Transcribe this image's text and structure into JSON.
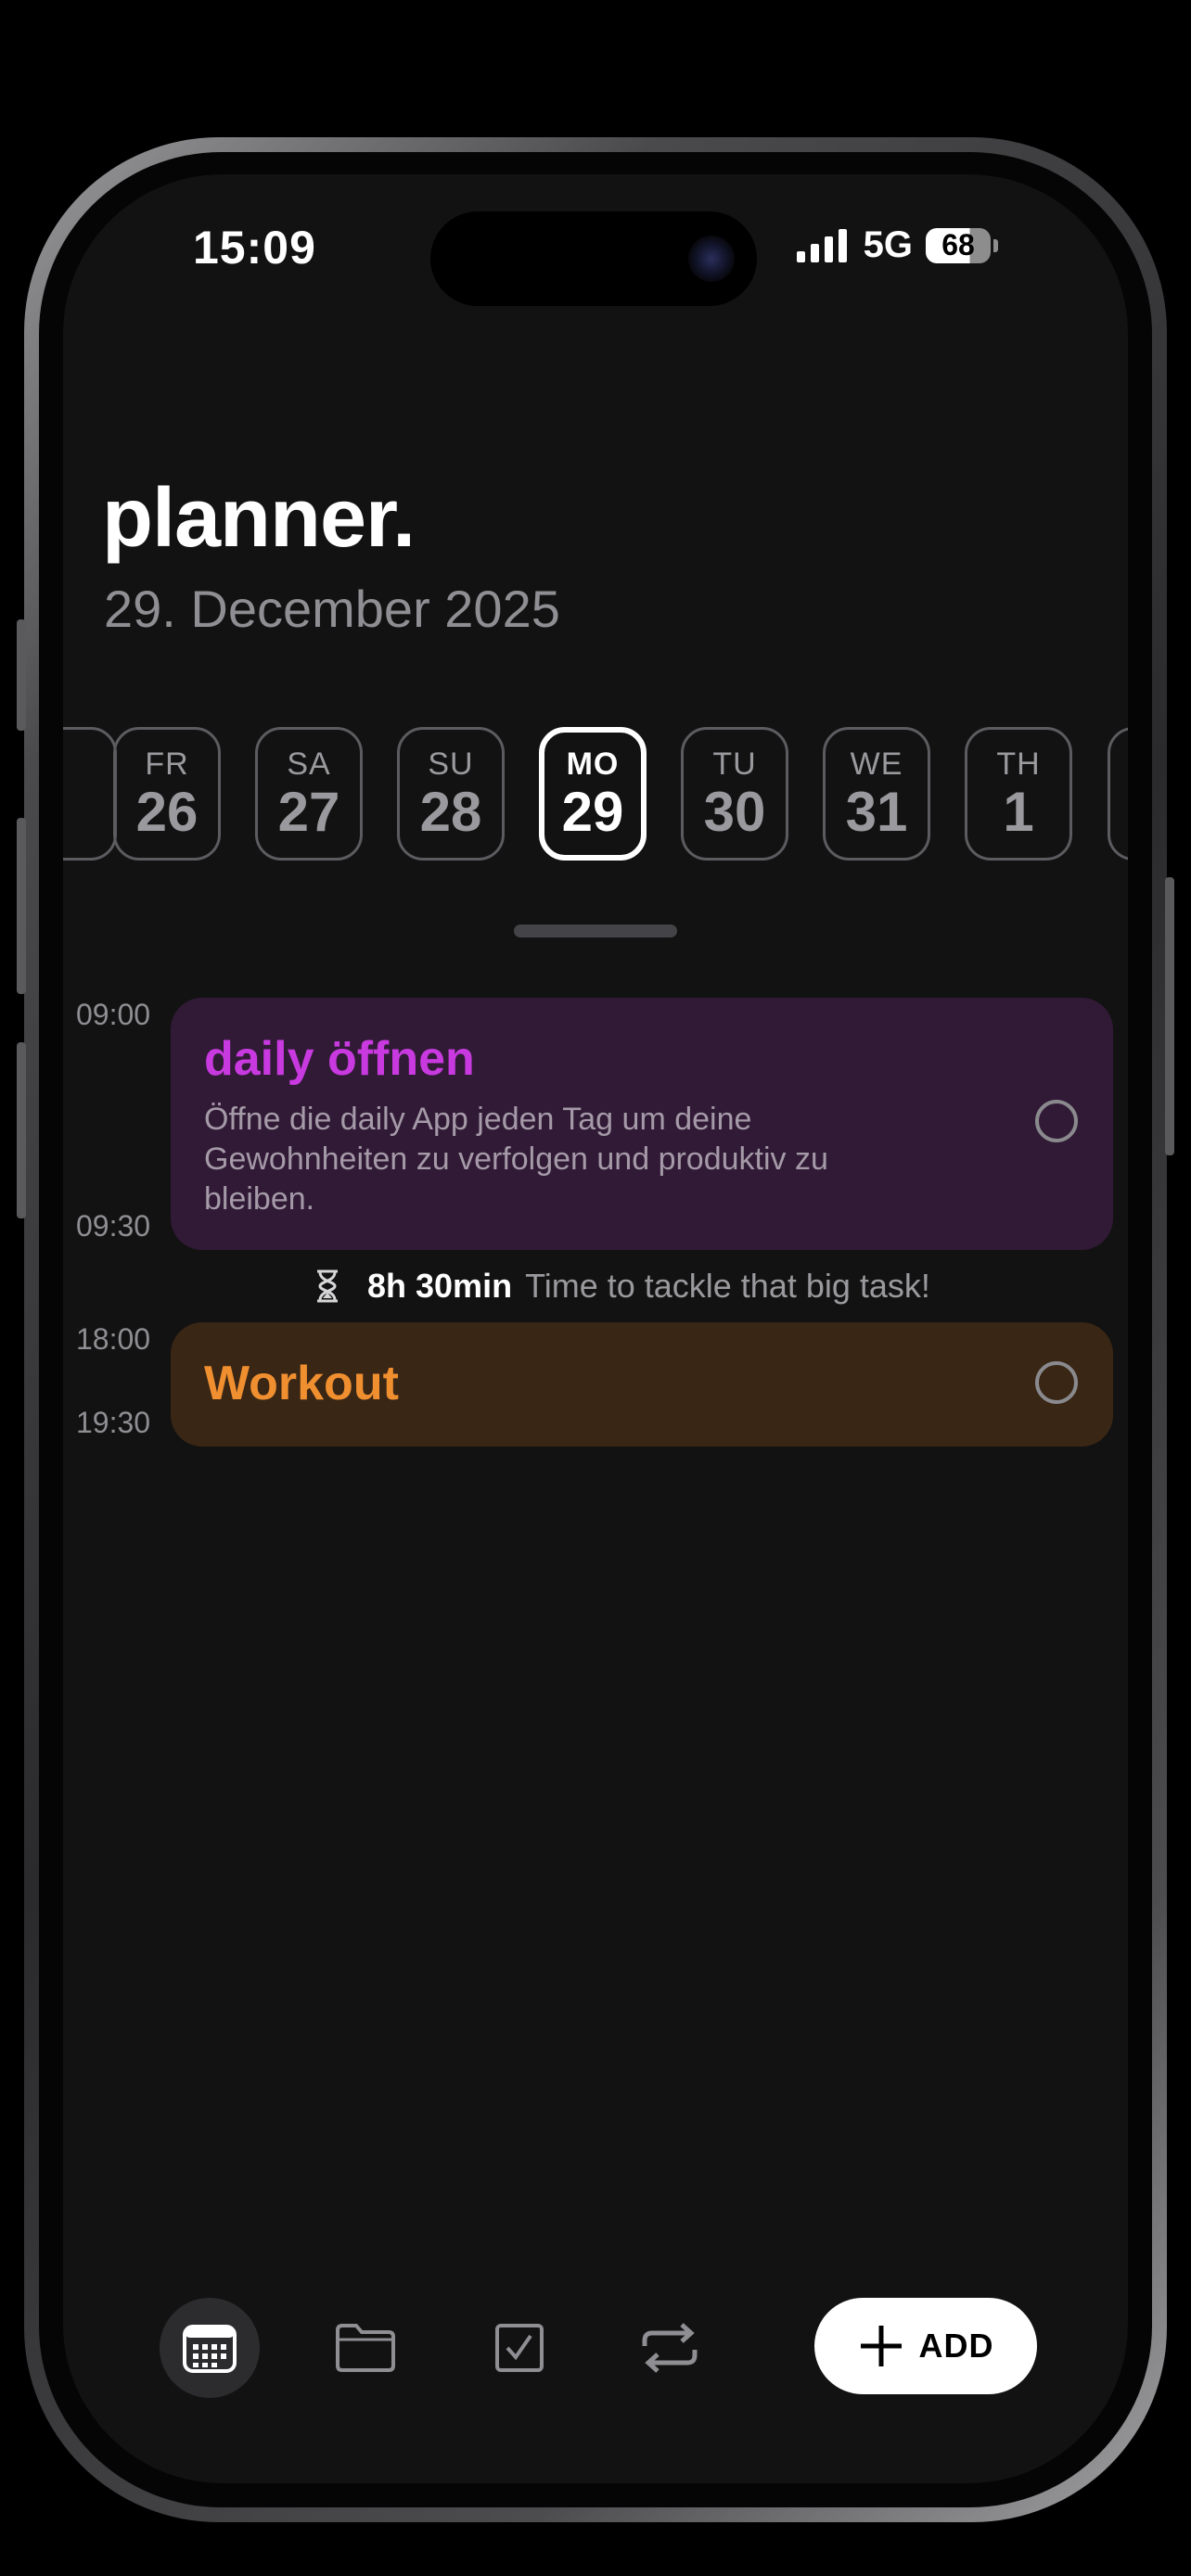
{
  "status_bar": {
    "time": "15:09",
    "network": "5G",
    "battery": "68"
  },
  "header": {
    "title": "planner.",
    "date": "29. December 2025"
  },
  "days": [
    {
      "name": "FR",
      "num": "26",
      "selected": false
    },
    {
      "name": "SA",
      "num": "27",
      "selected": false
    },
    {
      "name": "SU",
      "num": "28",
      "selected": false
    },
    {
      "name": "MO",
      "num": "29",
      "selected": true
    },
    {
      "name": "TU",
      "num": "30",
      "selected": false
    },
    {
      "name": "WE",
      "num": "31",
      "selected": false
    },
    {
      "name": "TH",
      "num": "1",
      "selected": false
    }
  ],
  "events": [
    {
      "title": "daily öffnen",
      "description": "Öffne die daily App jeden Tag um deine Gewohnheiten zu verfolgen und produktiv zu bleiben.",
      "start": "09:00",
      "end": "09:30",
      "color": "#c83ae0",
      "background": "#311a36",
      "completed": false
    },
    {
      "title": "Workout",
      "start": "18:00",
      "end": "19:30",
      "color": "#f08f30",
      "background": "#392615",
      "completed": false
    }
  ],
  "gap": {
    "duration": "8h 30min",
    "message": "Time to tackle that big task!",
    "icon": "hourglass-icon"
  },
  "tabbar": {
    "tabs": [
      {
        "name": "calendar",
        "icon": "calendar-icon",
        "active": true
      },
      {
        "name": "folder",
        "icon": "folder-icon",
        "active": false
      },
      {
        "name": "tasks",
        "icon": "checkbox-icon",
        "active": false
      },
      {
        "name": "repeat",
        "icon": "repeat-icon",
        "active": false
      }
    ],
    "add_label": "ADD"
  }
}
